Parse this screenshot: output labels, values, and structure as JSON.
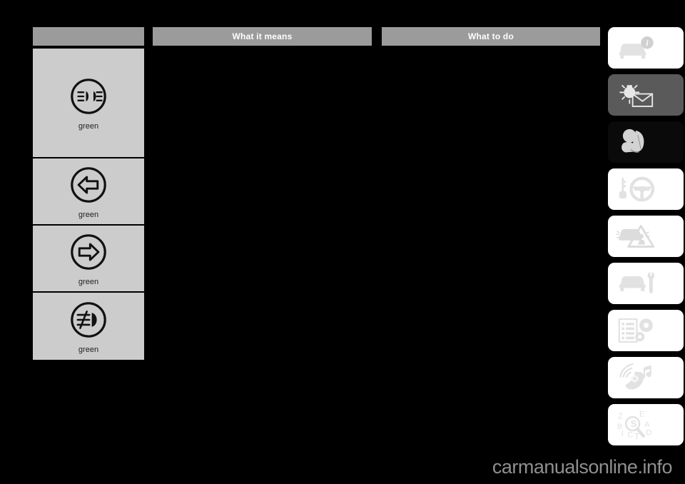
{
  "page": {
    "background": "#000000",
    "watermark": "carmanualsonline.info"
  },
  "table": {
    "headers": [
      {
        "id": "symbol",
        "label": ""
      },
      {
        "id": "what-means",
        "label": "What it means"
      },
      {
        "id": "what-to-do",
        "label": "What to do"
      }
    ],
    "header_bg": "#9b9b9b",
    "header_text_color": "#ffffff",
    "cell_bg": "#cccccc",
    "rows": [
      {
        "icon": "high-beam-indicator-icon",
        "icon_title": "High beam headlights indicator",
        "color_label": "green",
        "what_it_means": "",
        "what_to_do": ""
      },
      {
        "icon": "left-turn-signal-icon",
        "icon_title": "Left turn signal indicator",
        "color_label": "green",
        "what_it_means": "",
        "what_to_do": ""
      },
      {
        "icon": "right-turn-signal-icon",
        "icon_title": "Right turn signal indicator",
        "color_label": "green",
        "what_it_means": "",
        "what_to_do": ""
      },
      {
        "icon": "front-fog-lamp-icon",
        "icon_title": "Front fog lamp indicator",
        "color_label": "green",
        "what_it_means": "",
        "what_to_do": ""
      }
    ]
  },
  "tab_rail": {
    "tabs": [
      {
        "id": "at-a-glance",
        "icon": "car-info-icon",
        "state": "normal"
      },
      {
        "id": "warning-lamps",
        "icon": "lamp-message-icon",
        "state": "muted"
      },
      {
        "id": "safety",
        "icon": "child-seat-icon",
        "state": "current"
      },
      {
        "id": "driving",
        "icon": "key-steering-icon",
        "state": "normal"
      },
      {
        "id": "roadside-emergency",
        "icon": "breakdown-icon",
        "state": "normal"
      },
      {
        "id": "servicing",
        "icon": "car-wrench-icon",
        "state": "normal"
      },
      {
        "id": "specifications",
        "icon": "list-gears-icon",
        "state": "normal"
      },
      {
        "id": "infotainment",
        "icon": "audio-nav-icon",
        "state": "normal"
      },
      {
        "id": "index",
        "icon": "index-search-icon",
        "state": "normal"
      }
    ]
  }
}
